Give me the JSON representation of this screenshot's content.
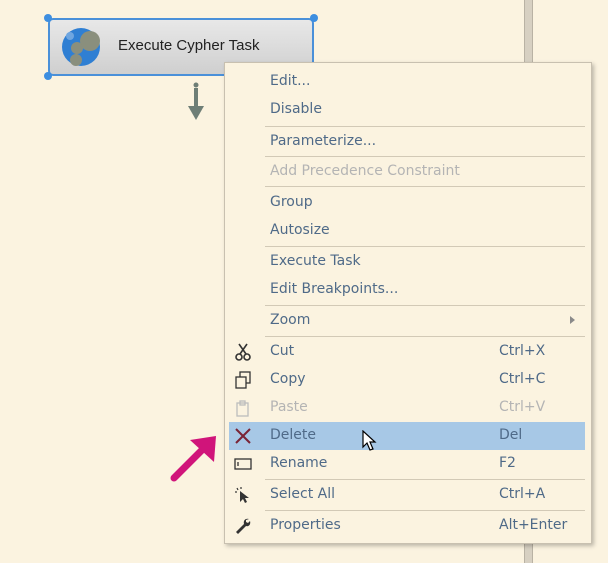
{
  "task": {
    "title": "Execute Cypher Task",
    "icon": "neo4j-logo-icon"
  },
  "menu": {
    "edit": "Edit...",
    "disable": "Disable",
    "parameterize": "Parameterize...",
    "add_precedence": "Add Precedence Constraint",
    "group": "Group",
    "autosize": "Autosize",
    "execute_task": "Execute Task",
    "edit_breakpoints": "Edit Breakpoints...",
    "zoom": "Zoom",
    "cut": "Cut",
    "cut_sc": "Ctrl+X",
    "copy": "Copy",
    "copy_sc": "Ctrl+C",
    "paste": "Paste",
    "paste_sc": "Ctrl+V",
    "delete": "Delete",
    "delete_sc": "Del",
    "rename": "Rename",
    "rename_sc": "F2",
    "select_all": "Select All",
    "select_all_sc": "Ctrl+A",
    "properties": "Properties",
    "properties_sc": "Alt+Enter"
  },
  "colors": {
    "highlight": "#a7c8e6",
    "annotation_arrow": "#d0147a",
    "text": "#4f6a88"
  }
}
